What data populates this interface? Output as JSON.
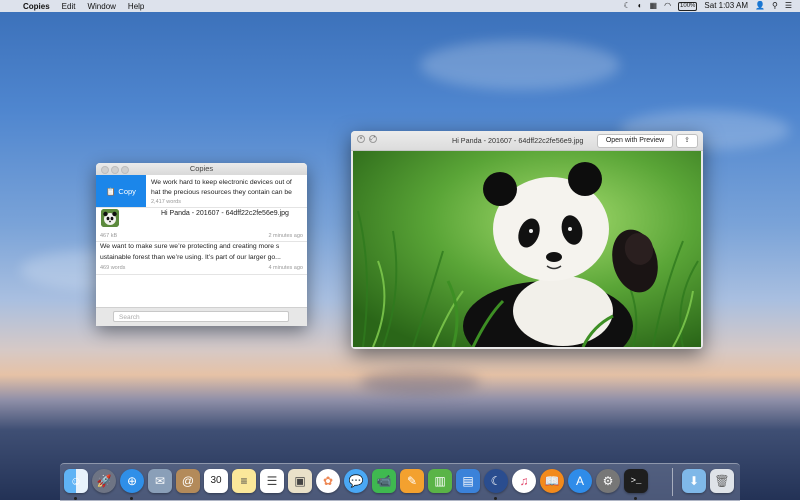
{
  "menubar": {
    "app_name": "Copies",
    "items": [
      "Edit",
      "Window",
      "Help"
    ],
    "battery": "100%",
    "clock": "Sat 1:03 AM"
  },
  "copies_window": {
    "title": "Copies",
    "copy_action_label": "Copy",
    "items": [
      {
        "text_line1": "We work hard to keep electronic devices out of",
        "text_line2": "hat the precious resources they contain can be",
        "meta_left": "2,417 words",
        "meta_right": ""
      },
      {
        "text_line1": "Hi Panda - 201607 - 64dff22c2fe56e9.jpg",
        "meta_left": "467 kB",
        "meta_right": "2 minutes ago"
      },
      {
        "text_line1": "We want to make sure we’re protecting and creating more s",
        "text_line2": "ustainable forest than we’re using. It’s part of our larger go...",
        "meta_left": "469 words",
        "meta_right": "4 minutes ago"
      }
    ],
    "search_placeholder": "Search"
  },
  "preview_window": {
    "title": "Hi Panda - 201607 - 64dff22c2fe56e9.jpg",
    "open_button": "Open with Preview",
    "share_icon": "share-icon"
  },
  "dock": {
    "icons": [
      "finder-icon",
      "launchpad-icon",
      "safari-icon",
      "mail-icon",
      "contacts-icon",
      "calendar-icon",
      "notes-icon",
      "reminders-icon",
      "preview-icon",
      "photos-icon",
      "messages-icon",
      "facetime-icon",
      "pages-icon",
      "numbers-icon",
      "keynote-icon",
      "itunes-icon",
      "ibooks-icon",
      "app-store-icon",
      "system-preferences-icon",
      "terminal-icon",
      "downloads-folder-icon",
      "trash-icon"
    ],
    "calendar_day": "30"
  }
}
